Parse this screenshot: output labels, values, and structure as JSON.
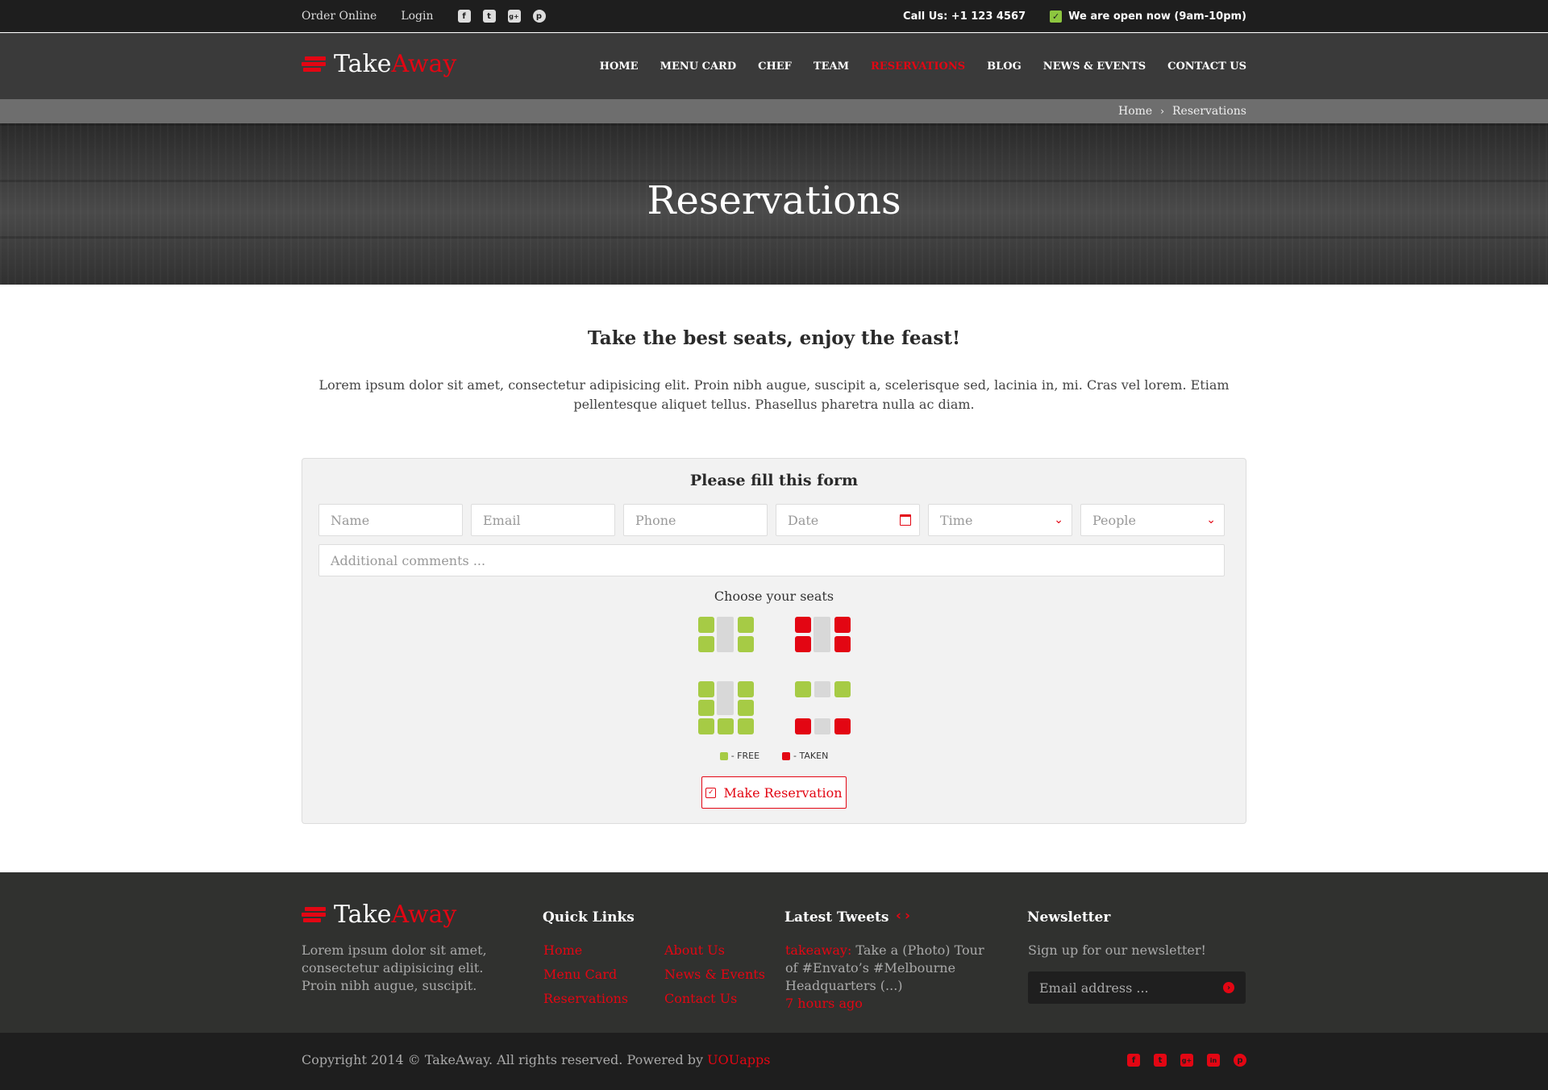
{
  "topbar": {
    "order_online": "Order Online",
    "login": "Login",
    "socials": [
      {
        "icon": "facebook-icon",
        "glyph": "f"
      },
      {
        "icon": "twitter-icon",
        "glyph": "t"
      },
      {
        "icon": "google-plus-icon",
        "glyph": "g+"
      },
      {
        "icon": "pinterest-icon",
        "glyph": "p"
      }
    ],
    "call": "Call Us: +1 123 4567",
    "open": "We are open now (9am-10pm)"
  },
  "logo": {
    "part1": "Take",
    "part2": "Away"
  },
  "nav": {
    "items": [
      "HOME",
      "MENU CARD",
      "CHEF",
      "TEAM",
      "RESERVATIONS",
      "BLOG",
      "NEWS & EVENTS",
      "CONTACT US"
    ],
    "active": "RESERVATIONS"
  },
  "breadcrumb": {
    "home": "Home",
    "separator": "›",
    "current": "Reservations"
  },
  "hero": {
    "title": "Reservations"
  },
  "intro": {
    "title": "Take the best seats, enjoy the feast!",
    "text": "Lorem ipsum dolor sit amet, consectetur adipisicing elit. Proin nibh augue, suscipit a, scelerisque sed, lacinia in, mi. Cras vel lorem. Etiam pellentesque aliquet tellus. Phasellus pharetra nulla ac diam."
  },
  "form": {
    "title": "Please fill this form",
    "name_placeholder": "Name",
    "email_placeholder": "Email",
    "phone_placeholder": "Phone",
    "date_placeholder": "Date",
    "time_placeholder": "Time",
    "people_placeholder": "People",
    "comments_placeholder": "Additional comments ...",
    "seats_label": "Choose your seats",
    "legend_free": "- FREE",
    "legend_taken": "- TAKEN",
    "submit_label": "Make Reservation"
  },
  "seating": {
    "tables": [
      {
        "name": "table-1",
        "seats": [
          "free",
          "free",
          "free",
          "free"
        ]
      },
      {
        "name": "table-2",
        "seats": [
          "taken",
          "taken",
          "taken",
          "taken"
        ]
      },
      {
        "name": "table-3",
        "seats": [
          "free",
          "free",
          "free",
          "free",
          "free",
          "free",
          "free"
        ]
      },
      {
        "name": "table-4",
        "seats": [
          "free",
          "free",
          "taken",
          "taken"
        ]
      }
    ]
  },
  "colors": {
    "accent": "#e30613",
    "free": "#a6cb45",
    "taken": "#e30613",
    "open_check": "#8dc63f"
  },
  "footer": {
    "about": "Lorem ipsum dolor sit amet, consectetur adipisicing elit. Proin nibh augue, suscipit.",
    "quick_links_title": "Quick Links",
    "quick_links": [
      "Home",
      "About Us",
      "Menu Card",
      "News & Events",
      "Reservations",
      "Contact Us"
    ],
    "tweets_title": "Latest Tweets",
    "tweet": {
      "handle": "takeaway:",
      "text": " Take a (Photo) Tour of #Envato’s #Melbourne Headquarters (...)",
      "time": "7 hours ago"
    },
    "newsletter_title": "Newsletter",
    "newsletter_text": "Sign up for our newsletter!",
    "newsletter_placeholder": "Email address ..."
  },
  "bottom": {
    "copyright": "Copyright 2014 © TakeAway. All rights reserved. Powered by ",
    "powered_by": "UOUapps",
    "socials": [
      {
        "icon": "facebook-icon",
        "glyph": "f"
      },
      {
        "icon": "twitter-icon",
        "glyph": "t"
      },
      {
        "icon": "google-plus-icon",
        "glyph": "g+"
      },
      {
        "icon": "linkedin-icon",
        "glyph": "in"
      },
      {
        "icon": "pinterest-icon",
        "glyph": "p"
      }
    ]
  }
}
